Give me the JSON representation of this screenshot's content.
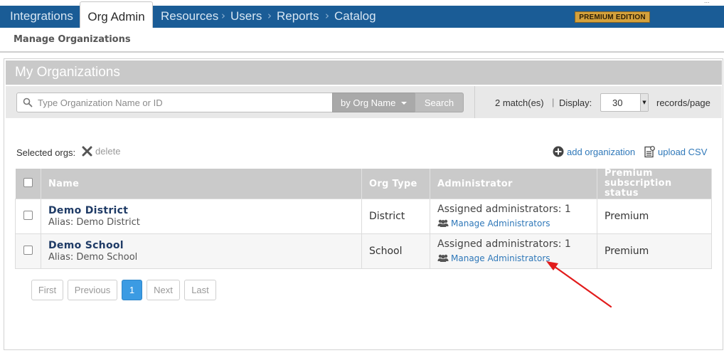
{
  "topnav": {
    "tabs": [
      {
        "label": "Integrations",
        "active": false
      },
      {
        "label": "Org Admin",
        "active": true
      },
      {
        "label": "Resources",
        "active": false
      },
      {
        "label": "Users",
        "active": false
      },
      {
        "label": "Reports",
        "active": false
      },
      {
        "label": "Catalog",
        "active": false
      }
    ],
    "separator": "›",
    "badge": "PREMIUM EDITION",
    "corner_mark": "..."
  },
  "subnav": {
    "title": "Manage Organizations"
  },
  "panel": {
    "title": "My Organizations"
  },
  "search": {
    "placeholder": "Type Organization Name or ID",
    "value": "",
    "filter_label": "by Org Name",
    "button": "Search",
    "matches": "2 match(es)",
    "pipe": "|",
    "display_label": "Display:",
    "display_value": "30",
    "records_label": "records/page"
  },
  "actions": {
    "selected_label": "Selected orgs:",
    "delete": "delete",
    "add": "add organization",
    "upload": "upload CSV"
  },
  "table": {
    "headers": [
      "Name",
      "Org Type",
      "Administrator",
      "Premium",
      "subscription status"
    ],
    "rows": [
      {
        "name": "Demo District",
        "alias": "Alias: Demo District",
        "type": "District",
        "assigned": "Assigned administrators: 1",
        "manage": "Manage Administrators",
        "status": "Premium"
      },
      {
        "name": "Demo School",
        "alias": "Alias: Demo School",
        "type": "School",
        "assigned": "Assigned administrators: 1",
        "manage": "Manage Administrators",
        "status": "Premium"
      }
    ]
  },
  "pagination": {
    "first": "First",
    "previous": "Previous",
    "current": "1",
    "next": "Next",
    "last": "Last"
  },
  "colors": {
    "nav": "#1a5c96",
    "badge": "#d4a13c",
    "link": "#2f78b9",
    "active_page": "#3b9be3",
    "annotation_arrow": "#e21b1b"
  }
}
